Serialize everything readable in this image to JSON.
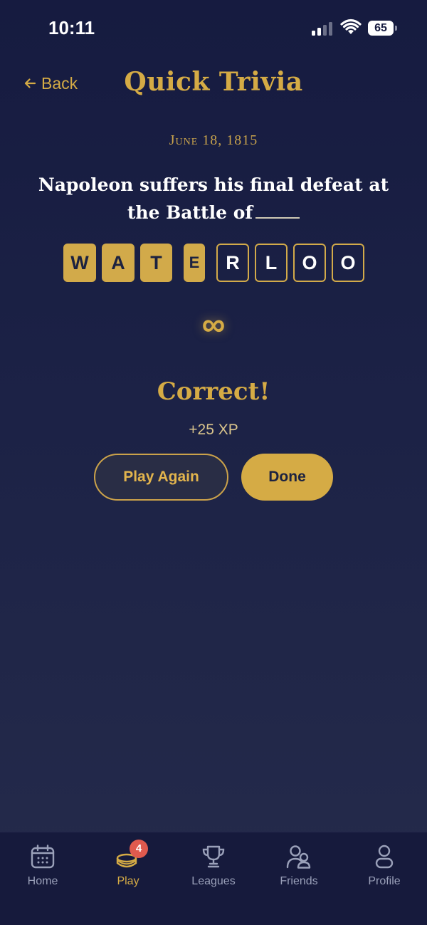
{
  "status_bar": {
    "time": "10:11",
    "battery": "65"
  },
  "header": {
    "back_label": "Back",
    "title": "Quick Trivia"
  },
  "question": {
    "date": "June 18, 1815",
    "text": "Napoleon suffers his final defeat at the Battle of"
  },
  "answer_tiles": [
    {
      "letter": "W",
      "state": "filled"
    },
    {
      "letter": "A",
      "state": "filled"
    },
    {
      "letter": "T",
      "state": "filled"
    },
    {
      "letter": "E",
      "state": "filled"
    },
    {
      "letter": "R",
      "state": "outline"
    },
    {
      "letter": "L",
      "state": "outline"
    },
    {
      "letter": "O",
      "state": "outline"
    },
    {
      "letter": "O",
      "state": "outline"
    }
  ],
  "lives_symbol": "∞",
  "result": {
    "title": "Correct!",
    "xp": "+25 XP"
  },
  "actions": {
    "play_again": "Play Again",
    "done": "Done"
  },
  "tab_bar": {
    "items": [
      {
        "label": "Home",
        "icon": "calendar-icon"
      },
      {
        "label": "Play",
        "icon": "coins-icon",
        "badge": "4",
        "active": true
      },
      {
        "label": "Leagues",
        "icon": "trophy-icon"
      },
      {
        "label": "Friends",
        "icon": "users-icon"
      },
      {
        "label": "Profile",
        "icon": "person-icon"
      }
    ]
  },
  "colors": {
    "accent": "#d5ab45",
    "background": "#161b40",
    "badge": "#e05a4e"
  }
}
